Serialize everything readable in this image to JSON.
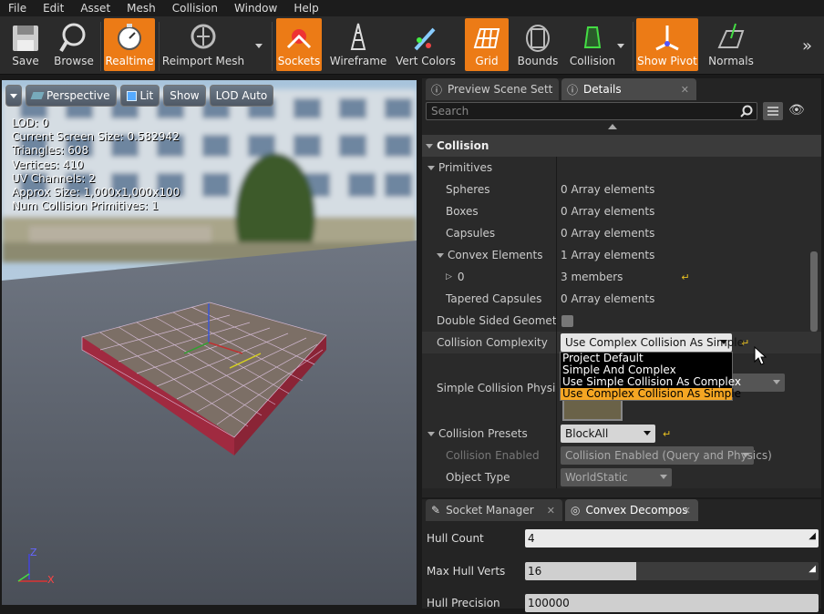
{
  "menu": [
    "File",
    "Edit",
    "Asset",
    "Mesh",
    "Collision",
    "Window",
    "Help"
  ],
  "toolbar": {
    "save": "Save",
    "browse": "Browse",
    "realtime": "Realtime",
    "reimport": "Reimport Mesh",
    "sockets": "Sockets",
    "wireframe": "Wireframe",
    "vertcolors": "Vert Colors",
    "grid": "Grid",
    "bounds": "Bounds",
    "collision": "Collision",
    "showpivot": "Show Pivot",
    "normals": "Normals"
  },
  "viewport": {
    "perspective": "Perspective",
    "lit": "Lit",
    "show": "Show",
    "lod": "LOD Auto",
    "stats": [
      "LOD:  0",
      "Current Screen Size:  0.582942",
      "Triangles:  608",
      "Vertices:  410",
      "UV Channels:  2",
      "Approx Size: 1,000x1,000x100",
      "Num Collision Primitives:  1"
    ],
    "axis_z": "Z",
    "axis_x": "X"
  },
  "details": {
    "tab_preview": "Preview Scene Sett",
    "tab_details": "Details",
    "search_placeholder": "Search",
    "category": "Collision",
    "rows": {
      "primitives": "Primitives",
      "spheres": "Spheres",
      "spheres_val": "0 Array elements",
      "boxes": "Boxes",
      "boxes_val": "0 Array elements",
      "capsules": "Capsules",
      "capsules_val": "0 Array elements",
      "convex": "Convex Elements",
      "convex_val": "1 Array elements",
      "zero": "0",
      "zero_val": "3 members",
      "tapered": "Tapered Capsules",
      "tapered_val": "0 Array elements",
      "doublesided": "Double Sided Geometry",
      "complexity": "Collision Complexity",
      "complexity_val": "Use Complex Collision As Simple",
      "simplephys": "Simple Collision Physical",
      "presets": "Collision Presets",
      "presets_val": "BlockAll",
      "enabled": "Collision Enabled",
      "enabled_val": "Collision Enabled (Query and Physics)",
      "objtype": "Object Type",
      "objtype_val": "WorldStatic"
    },
    "dropdown_options": [
      "Project Default",
      "Simple And Complex",
      "Use Simple Collision As Complex",
      "Use Complex Collision As Simple"
    ]
  },
  "bottom": {
    "tab_socket": "Socket Manager",
    "tab_convex": "Convex Decompos",
    "hull_count_label": "Hull Count",
    "hull_count": "4",
    "max_hull_label": "Max Hull Verts",
    "max_hull": "16",
    "max_hull_fill": 0.38,
    "hull_precision_label": "Hull Precision",
    "hull_precision": "100000"
  },
  "colors": {
    "accent": "#ec7b16",
    "selection": "#f5a623"
  }
}
